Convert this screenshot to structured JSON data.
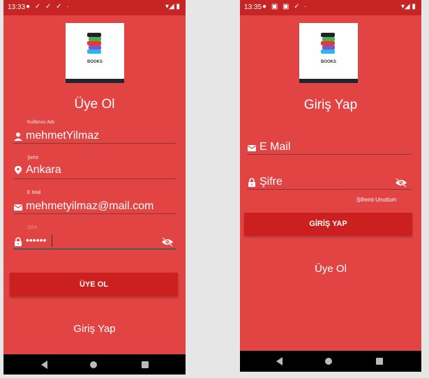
{
  "colors": {
    "background": "#e24444",
    "statusbar": "#c72525",
    "button": "#cc2020",
    "text": "#ffffff"
  },
  "logo": {
    "caption": "BOOKS"
  },
  "register": {
    "status_time": "13:33",
    "title": "Üye Ol",
    "username": {
      "label": "Kullanıcı Adı",
      "value": "mehmetYilmaz",
      "icon": "person-icon"
    },
    "city": {
      "label": "Şehir",
      "value": "Ankara",
      "icon": "location-pin-icon"
    },
    "email": {
      "label": "E Mail",
      "value": "mehmetyilmaz@mail.com",
      "icon": "mail-icon"
    },
    "password": {
      "label": "Şifre",
      "value": "••••••",
      "icon": "lock-icon"
    },
    "submit_label": "ÜYE OL",
    "login_link": "Giriş Yap"
  },
  "login": {
    "status_time": "13:35",
    "title": "Giriş Yap",
    "email_placeholder": "E Mail",
    "password_placeholder": "Şifre",
    "forgot_label": "Şifremi Unuttum",
    "submit_label": "GİRİŞ YAP",
    "register_link": "Üye Ol"
  }
}
